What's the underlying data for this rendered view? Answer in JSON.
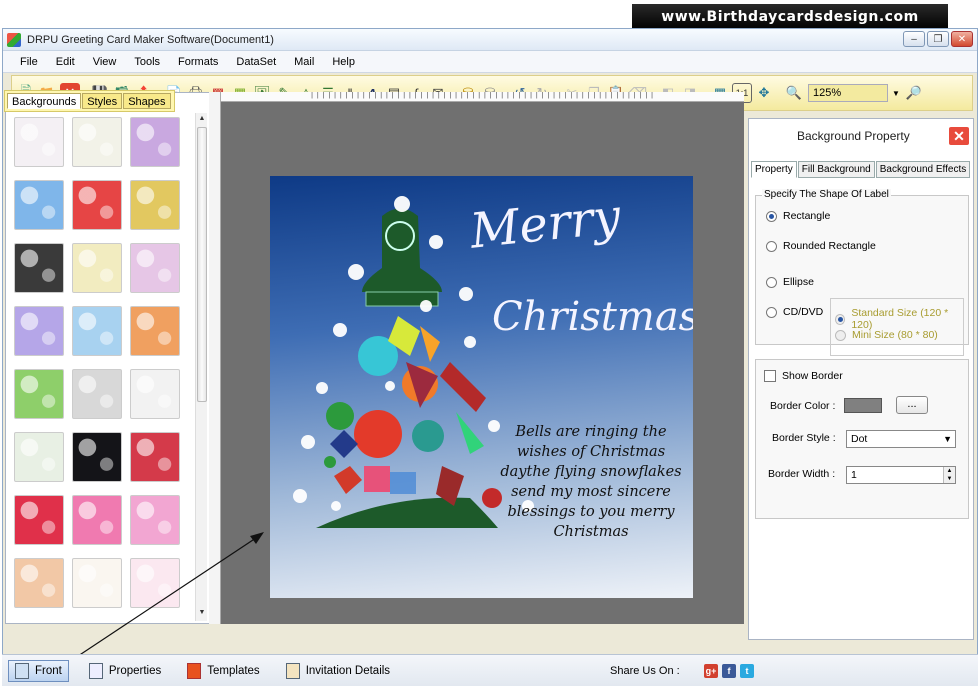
{
  "banner": {
    "text": "www.Birthdaycardsdesign.com"
  },
  "window": {
    "title": "DRPU Greeting Card Maker Software(Document1)"
  },
  "menu": [
    "File",
    "Edit",
    "View",
    "Tools",
    "Formats",
    "DataSet",
    "Mail",
    "Help"
  ],
  "toolbar": {
    "zoom": "125%"
  },
  "left_panel": {
    "tabs": [
      "Backgrounds",
      "Styles",
      "Shapes"
    ],
    "thumb_colors": [
      "#f4f0f4",
      "#f2f2e8",
      "#c9a8e0",
      "#7fb6ea",
      "#e64545",
      "#e2c860",
      "#3a3a3a",
      "#f2ecc0",
      "#e6c6e6",
      "#b5a6e8",
      "#a8d2f0",
      "#f0a060",
      "#8ecf6a",
      "#d8d8d8",
      "#f2f2f2",
      "#e8f0e4",
      "#141418",
      "#d43a4a",
      "#e0304a",
      "#f07ab0",
      "#f2a6d2",
      "#f2c8a6",
      "#faf6f0",
      "#fbe8f0"
    ]
  },
  "card": {
    "merry": "Merry",
    "christmas": "Christmas",
    "message": "Bells are ringing the wishes of Christmas daythe flying snowflakes send my most sincere blessings to you merry Christmas"
  },
  "right_panel": {
    "title": "Background Property",
    "tabs": [
      "Property",
      "Fill Background",
      "Background Effects"
    ],
    "shape_legend": "Specify The Shape Of Label",
    "shapes": {
      "rectangle": "Rectangle",
      "rounded": "Rounded Rectangle",
      "ellipse": "Ellipse",
      "cd": "CD/DVD",
      "standard": "Standard Size (120 * 120)",
      "mini": "Mini Size (80 * 80)"
    },
    "show_border": "Show Border",
    "border_color_label": "Border Color :",
    "dots": "...",
    "border_style_label": "Border Style :",
    "border_style_value": "Dot",
    "border_width_label": "Border Width :",
    "border_width_value": "1"
  },
  "statusbar": {
    "front": "Front",
    "properties": "Properties",
    "templates": "Templates",
    "invitation": "Invitation Details",
    "share": "Share Us On :"
  }
}
